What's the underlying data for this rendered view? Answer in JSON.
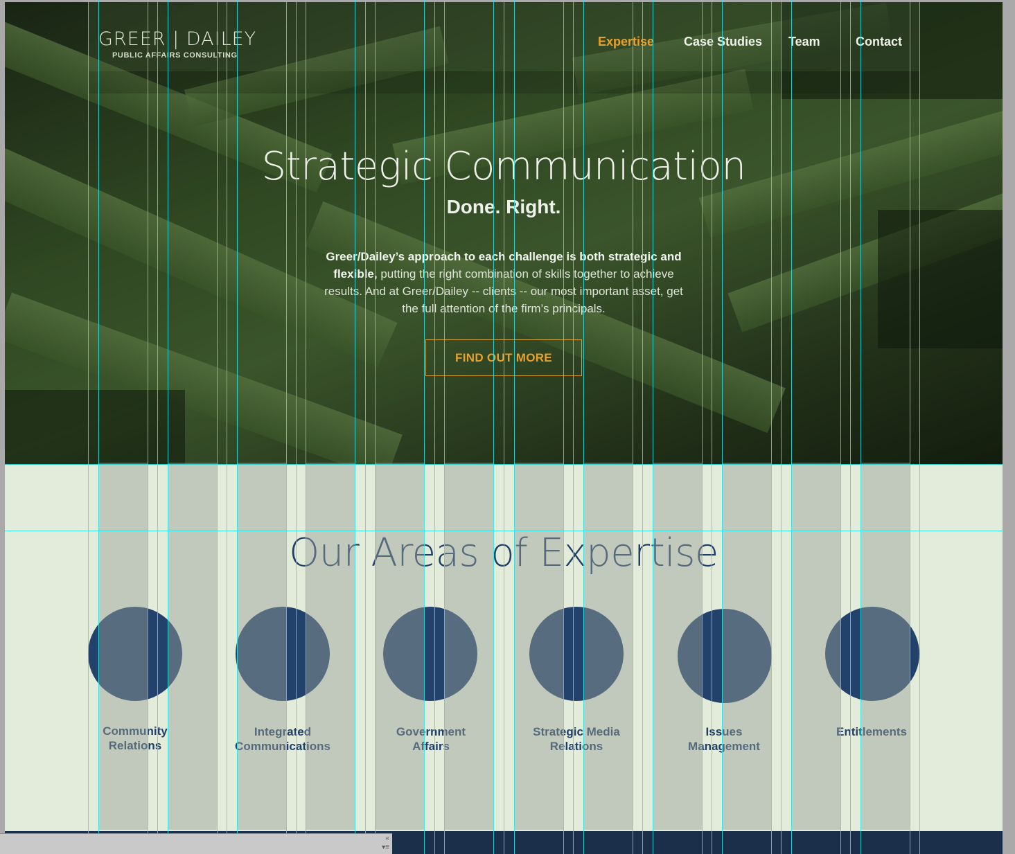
{
  "nav": {
    "logo_main": "GREER | DAILEY",
    "logo_sub": "PUBLIC AFFAIRS CONSULTING",
    "items": [
      "Expertise",
      "Case Studies",
      "Team",
      "Contact"
    ]
  },
  "hero": {
    "title": "Strategic Communication",
    "subtitle": "Done. Right.",
    "body_bold": "Greer/Dailey’s approach to each challenge is both strategic and flexible,",
    "body_rest": " putting the right combination of skills together to achieve results. And at Greer/Dailey -- clients -- our most important asset, get the full attention of the firm’s principals.",
    "cta": "FIND OUT MORE"
  },
  "expertise": {
    "title": "Our Areas of Expertise",
    "items": [
      {
        "line1": "Community",
        "line2": "Relations"
      },
      {
        "line1": "Integrated",
        "line2": "Communications"
      },
      {
        "line1": "Government",
        "line2": "Affairs"
      },
      {
        "line1": "Strategic Media",
        "line2": "Relations"
      },
      {
        "line1": "Issues",
        "line2": "Management"
      },
      {
        "line1": "Entitlements",
        "line2": ""
      }
    ]
  },
  "colors": {
    "accent": "#e6a12f",
    "navy": "#23426b",
    "section_bg": "#e3ecda",
    "guide": "#27e8e8"
  },
  "scroll": {
    "collapse_icon": "double-chevron-left-icon",
    "menu_icon": "dropdown-menu-icon"
  }
}
